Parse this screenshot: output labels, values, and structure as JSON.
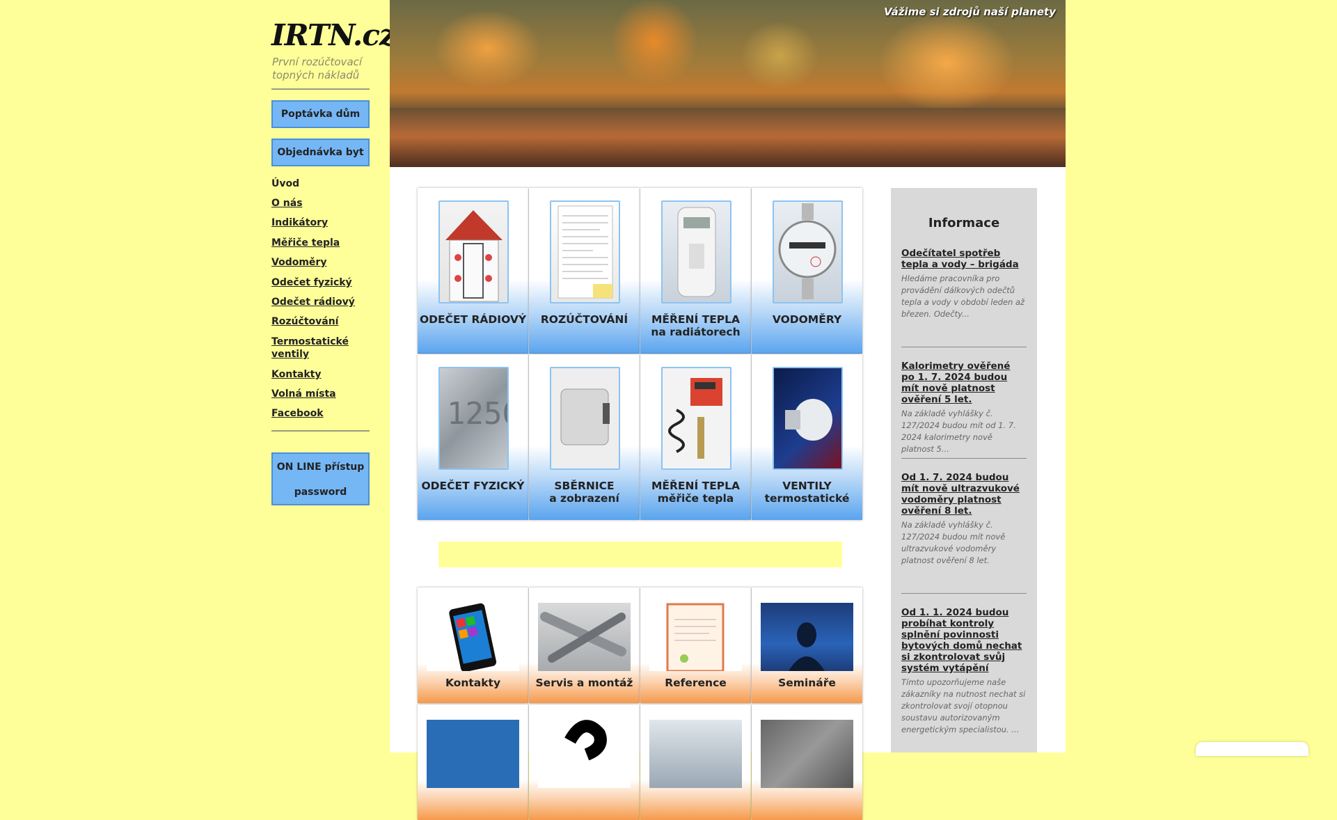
{
  "logo": {
    "text": "IRTN.cz",
    "subtitle": "První rozúčtovací topných nákladů"
  },
  "sidebar": {
    "buttons": [
      {
        "label": "Poptávka dům"
      },
      {
        "label": "Objednávka byt"
      }
    ],
    "nav": [
      {
        "label": "Úvod"
      },
      {
        "label": "O nás"
      },
      {
        "label": "Indikátory"
      },
      {
        "label": "Měřiče tepla"
      },
      {
        "label": "Vodoměry"
      },
      {
        "label": "Odečet fyzický"
      },
      {
        "label": "Odečet rádiový"
      },
      {
        "label": "Rozúčtování"
      },
      {
        "label": "Termostatické ventily"
      },
      {
        "label": "Kontakty"
      },
      {
        "label": "Volná místa"
      },
      {
        "label": "Facebook"
      }
    ],
    "online": {
      "line1": "ON LINE přístup",
      "line2": "password"
    }
  },
  "hero": {
    "tagline": "Vážime si zdrojů naší planety"
  },
  "services": [
    {
      "line1": "ODEČET RÁDIOVÝ",
      "line2": ""
    },
    {
      "line1": "ROZÚČTOVÁNÍ",
      "line2": ""
    },
    {
      "line1": "MĚŘENÍ TEPLA",
      "line2": "na radiátorech"
    },
    {
      "line1": "VODOMĚRY",
      "line2": ""
    },
    {
      "line1": "ODEČET FYZICKÝ",
      "line2": ""
    },
    {
      "line1": "SBĚRNICE",
      "line2": "a zobrazení"
    },
    {
      "line1": "MĚŘENÍ TEPLA",
      "line2": "měřiče tepla"
    },
    {
      "line1": "VENTILY",
      "line2": "termostatické"
    }
  ],
  "links": [
    {
      "label": "Kontakty"
    },
    {
      "label": "Servis a montáž"
    },
    {
      "label": "Reference"
    },
    {
      "label": "Semináře"
    }
  ],
  "info": {
    "title": "Informace",
    "news": [
      {
        "title": "Odečítatel spotřeb tepla a vody – brigáda",
        "text": "Hledáme pracovníka pro provádění dálkových odečtů tepla a vody v období leden až březen. Odečty..."
      },
      {
        "title": "Kalorimetry ověřené po 1. 7. 2024 budou mít nově platnost ověření 5 let.",
        "text": "Na základě vyhlášky č. 127/2024 budou mít od 1. 7. 2024 kalorimetry nově platnost 5..."
      },
      {
        "title": "Od 1. 7. 2024 budou mít nově ultrazvukové vodoměry platnost ověření 8 let.",
        "text": "Na základě vyhlášky č. 127/2024 budou mít nově ultrazvukové vodoměry platnost ověření 8 let."
      },
      {
        "title": "Od 1. 1. 2024 budou probíhat kontroly splnění povinnosti bytových domů nechat si zkontrolovat svůj systém vytápění",
        "text": "Tímto upozorňujeme naše zákazníky na nutnost nechat si zkontrolovat svojí otopnou soustavu autorizovaným energetickým specialistou. ..."
      }
    ]
  }
}
